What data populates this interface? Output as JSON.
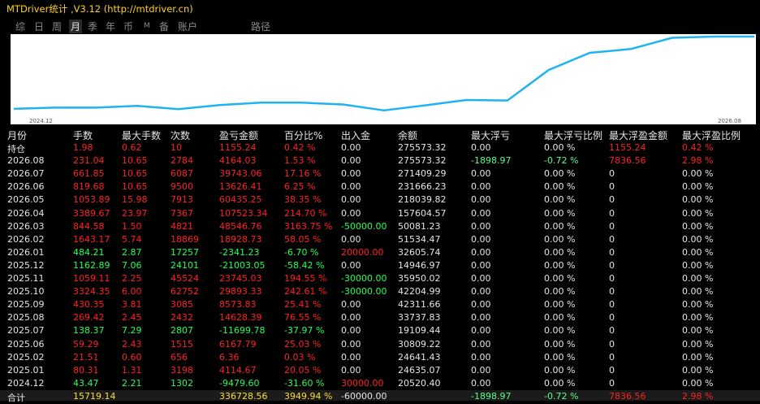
{
  "window": {
    "title": "MTDriver统计 ,V3.12 (http://mtdriver.cn)"
  },
  "tabs": [
    "综",
    "日",
    "周",
    "月",
    "季",
    "年",
    "币",
    "M",
    "备",
    "账户",
    "路径"
  ],
  "active_tab": "月",
  "chart": {
    "start_label": "2024.12",
    "end_label": "2026.08",
    "line_color": "#1fb3f0",
    "balance": [
      20520.4,
      24635.07,
      24641.43,
      30809.22,
      19109.44,
      33737.83,
      42311.66,
      42204.99,
      35950.02,
      14946.97,
      32605.74,
      51534.47,
      50081.23,
      157604.57,
      218039.82,
      231666.23,
      271409.29,
      275573.32,
      275573.32
    ]
  },
  "table": {
    "headers": [
      "月份",
      "手数",
      "最大手数",
      "次数",
      "盈亏金额",
      "百分比%",
      "出入金",
      "余额",
      "最大浮亏",
      "最大浮亏比例",
      "最大浮盈金额",
      "最大浮盈比例"
    ],
    "rows": [
      {
        "month": "持仓",
        "lots": "1.98",
        "max_lots": "0.62",
        "count": "10",
        "pnl": "1155.24",
        "pct": "0.42 %",
        "flow": "0.00",
        "balance": "275573.32",
        "max_float_loss": "0.00",
        "max_float_loss_pct": "0.00 %",
        "max_float_profit": "1155.24",
        "max_float_profit_pct": "0.42 %"
      },
      {
        "month": "2026.08",
        "lots": "231.04",
        "max_lots": "10.65",
        "count": "2784",
        "pnl": "4164.03",
        "pct": "1.53 %",
        "flow": "0.00",
        "balance": "275573.32",
        "max_float_loss": "-1898.97",
        "max_float_loss_pct": "-0.72 %",
        "max_float_profit": "7836.56",
        "max_float_profit_pct": "2.98 %"
      },
      {
        "month": "2026.07",
        "lots": "661.85",
        "max_lots": "10.65",
        "count": "6087",
        "pnl": "39743.06",
        "pct": "17.16 %",
        "flow": "0.00",
        "balance": "271409.29",
        "max_float_loss": "0.00",
        "max_float_loss_pct": "0.00 %",
        "max_float_profit": "0",
        "max_float_profit_pct": "0.00 %"
      },
      {
        "month": "2026.06",
        "lots": "819.68",
        "max_lots": "10.65",
        "count": "9500",
        "pnl": "13626.41",
        "pct": "6.25 %",
        "flow": "0.00",
        "balance": "231666.23",
        "max_float_loss": "0.00",
        "max_float_loss_pct": "0.00 %",
        "max_float_profit": "0",
        "max_float_profit_pct": "0.00 %"
      },
      {
        "month": "2026.05",
        "lots": "1053.89",
        "max_lots": "15.98",
        "count": "7913",
        "pnl": "60435.25",
        "pct": "38.35 %",
        "flow": "0.00",
        "balance": "218039.82",
        "max_float_loss": "0.00",
        "max_float_loss_pct": "0.00 %",
        "max_float_profit": "0",
        "max_float_profit_pct": "0.00 %"
      },
      {
        "month": "2026.04",
        "lots": "3389.67",
        "max_lots": "23.97",
        "count": "7367",
        "pnl": "107523.34",
        "pct": "214.70 %",
        "flow": "0.00",
        "balance": "157604.57",
        "max_float_loss": "0.00",
        "max_float_loss_pct": "0.00 %",
        "max_float_profit": "0",
        "max_float_profit_pct": "0.00 %"
      },
      {
        "month": "2026.03",
        "lots": "844.58",
        "max_lots": "1.50",
        "count": "4821",
        "pnl": "48546.76",
        "pct": "3163.75 %",
        "flow": "-50000.00",
        "balance": "50081.23",
        "max_float_loss": "0.00",
        "max_float_loss_pct": "0.00 %",
        "max_float_profit": "0",
        "max_float_profit_pct": "0.00 %"
      },
      {
        "month": "2026.02",
        "lots": "1643.17",
        "max_lots": "5.74",
        "count": "18869",
        "pnl": "18928.73",
        "pct": "58.05 %",
        "flow": "0.00",
        "balance": "51534.47",
        "max_float_loss": "0.00",
        "max_float_loss_pct": "0.00 %",
        "max_float_profit": "0",
        "max_float_profit_pct": "0.00 %"
      },
      {
        "month": "2026.01",
        "lots": "484.21",
        "max_lots": "2.87",
        "count": "17257",
        "pnl": "-2341.23",
        "pct": "-6.70 %",
        "flow": "20000.00",
        "balance": "32605.74",
        "max_float_loss": "0.00",
        "max_float_loss_pct": "0.00 %",
        "max_float_profit": "0",
        "max_float_profit_pct": "0.00 %"
      },
      {
        "month": "2025.12",
        "lots": "1162.89",
        "max_lots": "7.06",
        "count": "24101",
        "pnl": "-21003.05",
        "pct": "-58.42 %",
        "flow": "0.00",
        "balance": "14946.97",
        "max_float_loss": "0.00",
        "max_float_loss_pct": "0.00 %",
        "max_float_profit": "0",
        "max_float_profit_pct": "0.00 %"
      },
      {
        "month": "2025.11",
        "lots": "1059.11",
        "max_lots": "2.25",
        "count": "45524",
        "pnl": "23745.03",
        "pct": "194.55 %",
        "flow": "-30000.00",
        "balance": "35950.02",
        "max_float_loss": "0.00",
        "max_float_loss_pct": "0.00 %",
        "max_float_profit": "0",
        "max_float_profit_pct": "0.00 %"
      },
      {
        "month": "2025.10",
        "lots": "3324.35",
        "max_lots": "6.00",
        "count": "62752",
        "pnl": "29893.33",
        "pct": "242.61 %",
        "flow": "-30000.00",
        "balance": "42204.99",
        "max_float_loss": "0.00",
        "max_float_loss_pct": "0.00 %",
        "max_float_profit": "0",
        "max_float_profit_pct": "0.00 %"
      },
      {
        "month": "2025.09",
        "lots": "430.35",
        "max_lots": "3.81",
        "count": "3085",
        "pnl": "8573.83",
        "pct": "25.41 %",
        "flow": "0.00",
        "balance": "42311.66",
        "max_float_loss": "0.00",
        "max_float_loss_pct": "0.00 %",
        "max_float_profit": "0",
        "max_float_profit_pct": "0.00 %"
      },
      {
        "month": "2025.08",
        "lots": "269.42",
        "max_lots": "2.45",
        "count": "2432",
        "pnl": "14628.39",
        "pct": "76.55 %",
        "flow": "0.00",
        "balance": "33737.83",
        "max_float_loss": "0.00",
        "max_float_loss_pct": "0.00 %",
        "max_float_profit": "0",
        "max_float_profit_pct": "0.00 %"
      },
      {
        "month": "2025.07",
        "lots": "138.37",
        "max_lots": "7.29",
        "count": "2807",
        "pnl": "-11699.78",
        "pct": "-37.97 %",
        "flow": "0.00",
        "balance": "19109.44",
        "max_float_loss": "0.00",
        "max_float_loss_pct": "0.00 %",
        "max_float_profit": "0",
        "max_float_profit_pct": "0.00 %"
      },
      {
        "month": "2025.06",
        "lots": "59.29",
        "max_lots": "2.43",
        "count": "1515",
        "pnl": "6167.79",
        "pct": "25.03 %",
        "flow": "0.00",
        "balance": "30809.22",
        "max_float_loss": "0.00",
        "max_float_loss_pct": "0.00 %",
        "max_float_profit": "0",
        "max_float_profit_pct": "0.00 %"
      },
      {
        "month": "2025.02",
        "lots": "21.51",
        "max_lots": "0.60",
        "count": "656",
        "pnl": "6.36",
        "pct": "0.03 %",
        "flow": "0.00",
        "balance": "24641.43",
        "max_float_loss": "0.00",
        "max_float_loss_pct": "0.00 %",
        "max_float_profit": "0",
        "max_float_profit_pct": "0.00 %"
      },
      {
        "month": "2025.01",
        "lots": "80.31",
        "max_lots": "1.31",
        "count": "3198",
        "pnl": "4114.67",
        "pct": "20.05 %",
        "flow": "0.00",
        "balance": "24635.07",
        "max_float_loss": "0.00",
        "max_float_loss_pct": "0.00 %",
        "max_float_profit": "0",
        "max_float_profit_pct": "0.00 %"
      },
      {
        "month": "2024.12",
        "lots": "43.47",
        "max_lots": "2.21",
        "count": "1302",
        "pnl": "-9479.60",
        "pct": "-31.60 %",
        "flow": "30000.00",
        "balance": "20520.40",
        "max_float_loss": "0.00",
        "max_float_loss_pct": "0.00 %",
        "max_float_profit": "0",
        "max_float_profit_pct": "0.00 %"
      }
    ],
    "total": {
      "month": "合计",
      "lots": "15719.14",
      "max_lots": "",
      "count": "",
      "pnl": "336728.56",
      "pct": "3949.94 %",
      "flow": "-60000.00",
      "balance": "",
      "max_float_loss": "-1898.97",
      "max_float_loss_pct": "-0.72 %",
      "max_float_profit": "7836.56",
      "max_float_profit_pct": "2.98 %"
    }
  }
}
